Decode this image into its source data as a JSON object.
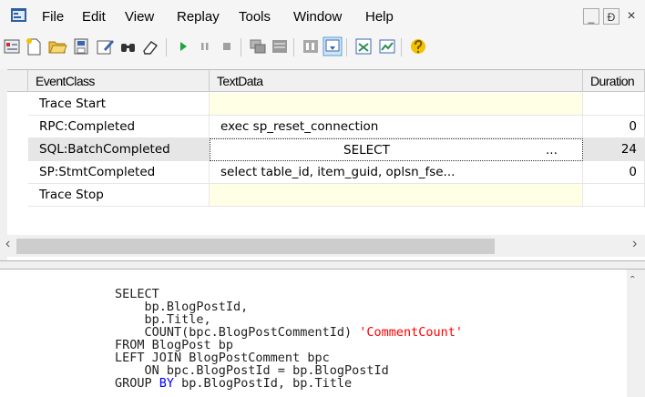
{
  "menu": [
    "File",
    "Edit",
    "View",
    "Replay",
    "Tools",
    "Window",
    "Help"
  ],
  "window_buttons": {
    "minimize": "_",
    "restore": "Ɖ",
    "close": "×"
  },
  "columns": [
    "EventClass",
    "TextData",
    "Duration"
  ],
  "rows": [
    {
      "event": "Trace Start",
      "text": "",
      "duration": ""
    },
    {
      "event": "RPC:Completed",
      "text": "exec sp_reset_connection",
      "duration": "0"
    },
    {
      "event": "SQL:BatchCompleted",
      "text": "SELECT",
      "text_more": "...",
      "duration": "24",
      "selected": true
    },
    {
      "event": "SP:StmtCompleted",
      "text": "select table_id, item_guid, oplsn_fse...",
      "duration": "0"
    },
    {
      "event": "Trace Stop",
      "text": "",
      "duration": ""
    }
  ],
  "sql": {
    "line1": "SELECT",
    "line2": "    bp.BlogPostId,",
    "line3": "    bp.Title,",
    "line4_func": "    COUNT(bpc.BlogPostCommentId) ",
    "line4_alias": "'CommentCount'",
    "line5": "FROM BlogPost bp",
    "line6": "LEFT JOIN BlogPostComment bpc",
    "line7": "    ON bpc.BlogPostId = bp.BlogPostId",
    "line8_a": "GROUP ",
    "line8_kw": "BY",
    "line8_b": " bp.BlogPostId, bp.Title"
  }
}
